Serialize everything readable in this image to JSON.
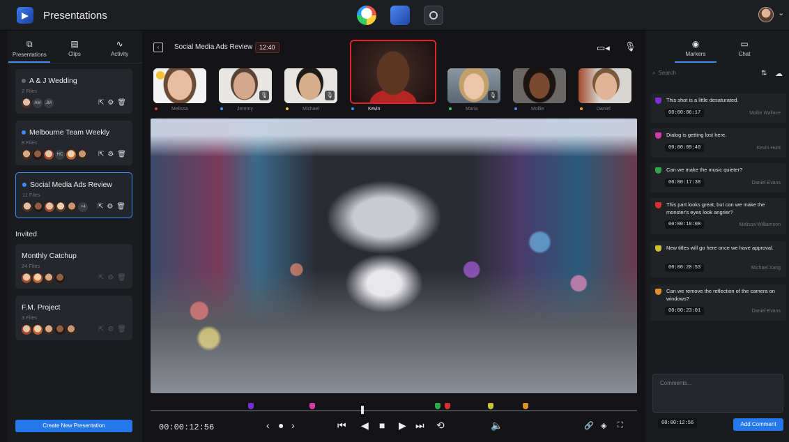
{
  "app": {
    "title": "Presentations"
  },
  "sidebar": {
    "tabs": [
      {
        "label": "Presentations",
        "icon": "presentations-icon",
        "active": true
      },
      {
        "label": "Clips",
        "icon": "clips-icon",
        "active": false
      },
      {
        "label": "Activity",
        "icon": "activity-icon",
        "active": false
      }
    ],
    "presentations": [
      {
        "name": "A & J Wedding",
        "files": "2 Files",
        "initials": [
          "AM",
          "JM"
        ]
      },
      {
        "name": "Melbourne Team Weekly",
        "files": "8 Files",
        "initials": [
          "HC"
        ]
      },
      {
        "name": "Social Media Ads Review",
        "files": "11 Files",
        "initials": [
          "+4"
        ]
      }
    ],
    "invited_label": "Invited",
    "invited": [
      {
        "name": "Monthly Catchup",
        "files": "24 Files"
      },
      {
        "name": "F.M. Project",
        "files": "3 Files"
      }
    ],
    "create_button": "Create New Presentation"
  },
  "center": {
    "title": "Social Media Ads Review",
    "duration": "12:40",
    "participants": [
      {
        "name": "Melissa",
        "dot_color": "#e23a3a"
      },
      {
        "name": "Jeremy",
        "dot_color": "#3a9cff"
      },
      {
        "name": "Michael",
        "dot_color": "#e8d23a"
      },
      {
        "name": "Kevin",
        "dot_color": "#3a8cff"
      },
      {
        "name": "Maria",
        "dot_color": "#3ac26b"
      },
      {
        "name": "Mollie",
        "dot_color": "#3a8cff"
      },
      {
        "name": "Daniel",
        "dot_color": "#f29a2e"
      }
    ],
    "timecode": "00:00:12:56"
  },
  "right": {
    "tabs": [
      {
        "label": "Markers",
        "icon": "marker-icon",
        "active": true
      },
      {
        "label": "Chat",
        "icon": "chat-icon",
        "active": false
      }
    ],
    "search_placeholder": "Search",
    "markers": [
      {
        "text": "This shot is a little desaturated.",
        "timecode": "00:00:06:17",
        "author": "Mollie Wallace",
        "color": "#7b2fd6"
      },
      {
        "text": "Dialog is getting lost here.",
        "timecode": "00:00:09:40",
        "author": "Kevin Hunt",
        "color": "#d43aa8"
      },
      {
        "text": "Can we make the music quieter?",
        "timecode": "00:00:17:38",
        "author": "Daniel Evans",
        "color": "#2fa84a"
      },
      {
        "text": "This part looks great, but can we make the monster's eyes look angrier?",
        "timecode": "00:00:18:08",
        "author": "Melissa Williamson",
        "color": "#d6302f"
      },
      {
        "text": "New titles will go here once we have approval.",
        "timecode": "00:00:20:53",
        "author": "Michael Xang",
        "color": "#c9c232"
      },
      {
        "text": "Can we remove the reflection of the camera on windows?",
        "timecode": "00:00:23:01",
        "author": "Daniel Evans",
        "color": "#e0922a"
      }
    ],
    "comment_placeholder": "Comments...",
    "comment_timecode": "00:00:12:56",
    "add_comment": "Add Comment"
  }
}
